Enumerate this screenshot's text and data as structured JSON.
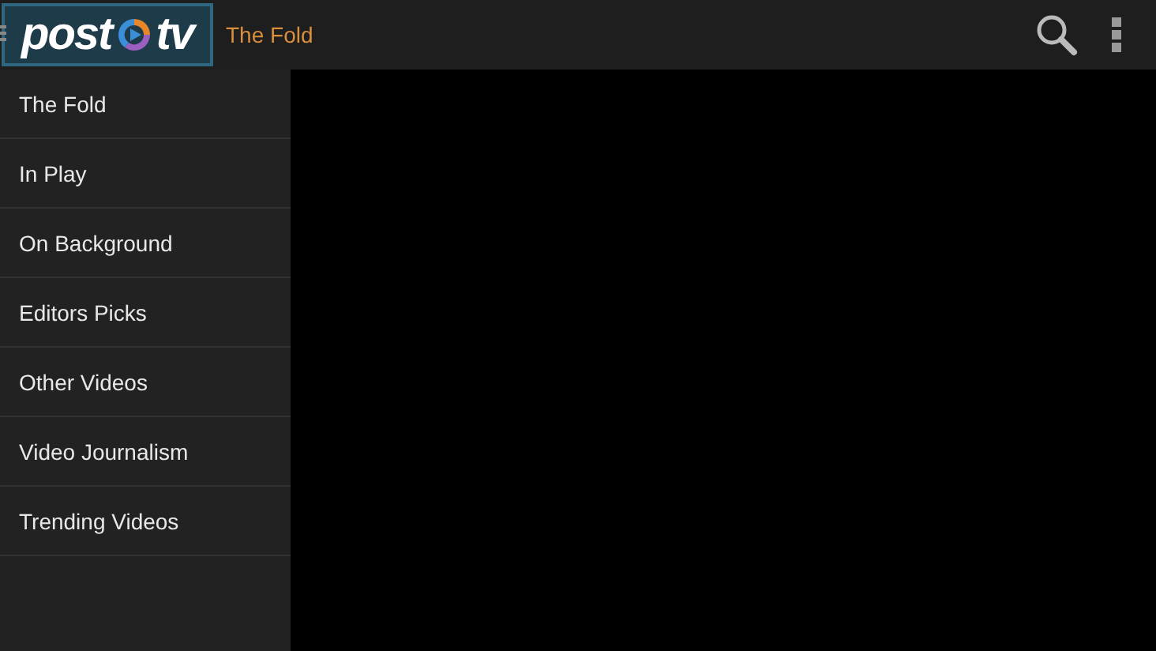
{
  "app_bar": {
    "logo_left": "post",
    "logo_right": "tv",
    "title": "The Fold"
  },
  "drawer": {
    "items": [
      {
        "label": "The Fold"
      },
      {
        "label": "In Play"
      },
      {
        "label": "On Background"
      },
      {
        "label": "Editors Picks"
      },
      {
        "label": "Other Videos"
      },
      {
        "label": "Video Journalism"
      },
      {
        "label": "Trending Videos"
      }
    ]
  }
}
